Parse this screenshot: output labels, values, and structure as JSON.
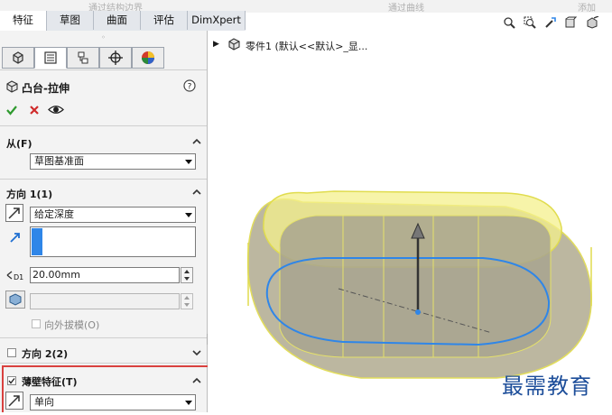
{
  "toolbar_faded": [
    "通过结构边界",
    "通过曲线",
    "添加"
  ],
  "command_tabs": [
    "特征",
    "草图",
    "曲面",
    "评估",
    "DimXpert"
  ],
  "active_tab": "特征",
  "panel_tabs": [
    "feature-manager",
    "property-manager",
    "configuration-manager",
    "dimxpert-manager",
    "display-manager"
  ],
  "feature": {
    "title": "凸台-拉伸",
    "help_icon": "question-icon"
  },
  "from": {
    "header": "从(F)",
    "value": "草图基准面"
  },
  "direction1": {
    "header": "方向 1(1)",
    "end_condition": "给定深度",
    "depth": "20.00mm",
    "draft_outward_label": "向外拔模(O)"
  },
  "direction2": {
    "header": "方向 2(2)"
  },
  "thin_feature": {
    "header": "薄壁特征(T)",
    "type": "单向"
  },
  "tree": {
    "part_label": "零件1 (默认<<默认>_显..."
  },
  "viewport_icons": [
    "zoom-to-fit-icon",
    "zoom-area-icon",
    "previous-view-icon",
    "section-view-icon",
    "view-orientation-icon"
  ],
  "watermark": "最需教育",
  "colors": {
    "accent_blue": "#2f86e8",
    "preview_yellow": "#f3f08a",
    "wall_gray": "#b8b5a0",
    "highlight_red": "#d9413f"
  }
}
